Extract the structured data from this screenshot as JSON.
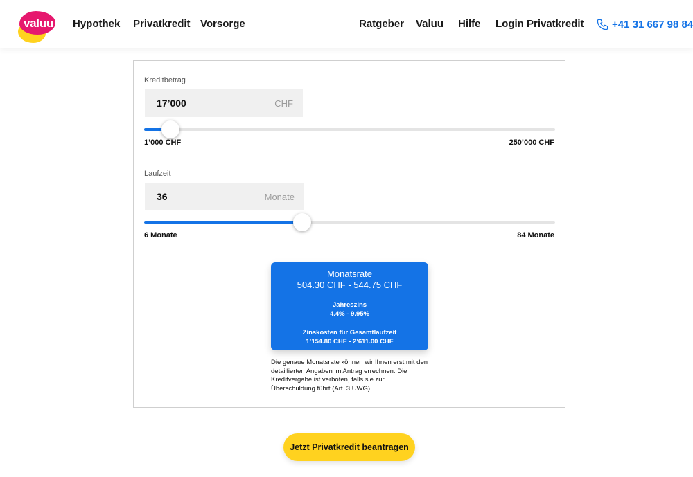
{
  "brand": {
    "logo_text": "valuu"
  },
  "nav": {
    "left": [
      "Hypothek",
      "Privatkredit",
      "Vorsorge"
    ],
    "right": [
      "Ratgeber",
      "Valuu",
      "Hilfe",
      "Login Privatkredit"
    ],
    "phone": "+41 31 667 98 84"
  },
  "calculator": {
    "amount": {
      "label": "Kreditbetrag",
      "value": "17’000",
      "unit": "CHF",
      "min_label": "1’000 CHF",
      "max_label": "250’000 CHF",
      "min": 1000,
      "max": 250000,
      "current": 17000
    },
    "duration": {
      "label": "Laufzeit",
      "value": "36",
      "unit": "Monate",
      "min_label": "6 Monate",
      "max_label": "84 Monate",
      "min": 6,
      "max": 84,
      "current": 36
    },
    "result": {
      "title": "Monatsrate",
      "rate": "504.30 CHF -  544.75 CHF",
      "interest_label": "Jahreszins",
      "interest_value": "4.4% - 9.95%",
      "cost_label": "Zinskosten für Gesamtlaufzeit",
      "cost_value": "1’154.80 CHF -  2’611.00 CHF"
    },
    "disclaimer": "Die genaue Monatsrate können wir Ihnen erst mit den detaillierten Angaben im Antrag errechnen. Die Kreditvergabe ist verboten, falls sie zur Überschuldung führt (Art. 3 UWG)."
  },
  "cta": {
    "label": "Jetzt Privatkredit beantragen"
  },
  "colors": {
    "accent": "#1473e6",
    "brand_pink": "#e6186e",
    "brand_yellow": "#ffd21f"
  }
}
